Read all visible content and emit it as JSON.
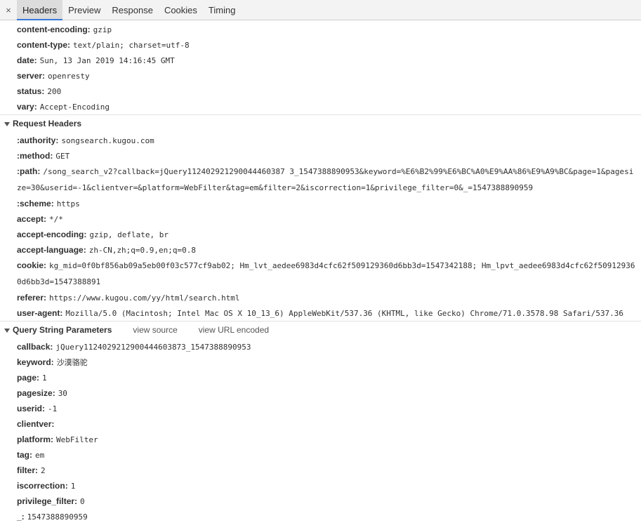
{
  "tabs": {
    "close": "×",
    "items": [
      {
        "label": "Headers",
        "active": true
      },
      {
        "label": "Preview",
        "active": false
      },
      {
        "label": "Response",
        "active": false
      },
      {
        "label": "Cookies",
        "active": false
      },
      {
        "label": "Timing",
        "active": false
      }
    ]
  },
  "response_headers": [
    {
      "key": "content-encoding:",
      "value": "gzip"
    },
    {
      "key": "content-type:",
      "value": "text/plain; charset=utf-8"
    },
    {
      "key": "date:",
      "value": "Sun, 13 Jan 2019 14:16:45 GMT"
    },
    {
      "key": "server:",
      "value": "openresty"
    },
    {
      "key": "status:",
      "value": "200"
    },
    {
      "key": "vary:",
      "value": "Accept-Encoding"
    }
  ],
  "request_headers": {
    "title": "Request Headers",
    "items": [
      {
        "key": ":authority:",
        "value": "songsearch.kugou.com"
      },
      {
        "key": ":method:",
        "value": "GET"
      },
      {
        "key": ":path:",
        "value": "/song_search_v2?callback=jQuery112402921290044460387 3_1547388890953&keyword=%E6%B2%99%E6%BC%A0%E9%AA%86%E9%A9%BC&page=1&pagesize=30&userid=-1&clientver=&platform=WebFilter&tag=em&filter=2&iscorrection=1&privilege_filter=0&_=1547388890959"
      },
      {
        "key": ":scheme:",
        "value": "https"
      },
      {
        "key": "accept:",
        "value": "*/*"
      },
      {
        "key": "accept-encoding:",
        "value": "gzip, deflate, br"
      },
      {
        "key": "accept-language:",
        "value": "zh-CN,zh;q=0.9,en;q=0.8"
      },
      {
        "key": "cookie:",
        "value": "kg_mid=0f0bf856ab09a5eb00f03c577cf9ab02; Hm_lvt_aedee6983d4cfc62f509129360d6bb3d=1547342188; Hm_lpvt_aedee6983d4cfc62f509129360d6bb3d=1547388891"
      },
      {
        "key": "referer:",
        "value": "https://www.kugou.com/yy/html/search.html"
      },
      {
        "key": "user-agent:",
        "value": "Mozilla/5.0 (Macintosh; Intel Mac OS X 10_13_6) AppleWebKit/537.36 (KHTML, like Gecko) Chrome/71.0.3578.98 Safari/537.36"
      }
    ]
  },
  "query_params": {
    "title": "Query String Parameters",
    "view_source": "view source",
    "view_url_encoded": "view URL encoded",
    "items": [
      {
        "key": "callback:",
        "value": "jQuery1124029212900444603873_1547388890953"
      },
      {
        "key": "keyword:",
        "value": "沙漠骆驼"
      },
      {
        "key": "page:",
        "value": "1"
      },
      {
        "key": "pagesize:",
        "value": "30"
      },
      {
        "key": "userid:",
        "value": "-1"
      },
      {
        "key": "clientver:",
        "value": ""
      },
      {
        "key": "platform:",
        "value": "WebFilter"
      },
      {
        "key": "tag:",
        "value": "em"
      },
      {
        "key": "filter:",
        "value": "2"
      },
      {
        "key": "iscorrection:",
        "value": "1"
      },
      {
        "key": "privilege_filter:",
        "value": "0"
      },
      {
        "key": "_:",
        "value": "1547388890959"
      }
    ]
  }
}
